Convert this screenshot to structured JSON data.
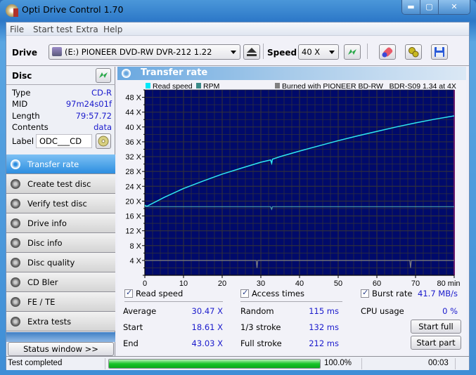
{
  "window": {
    "title": "Opti Drive Control 1.70",
    "buttons": {
      "minimize": "▬",
      "maximize": "▢",
      "close": "✕"
    }
  },
  "menu": [
    "File",
    "Start test",
    "Extra",
    "Help"
  ],
  "toolbar": {
    "drive_label": "Drive",
    "drive_value": "(E:)  PIONEER DVD-RW  DVR-212 1.22",
    "speed_label": "Speed",
    "speed_value": "40 X"
  },
  "disc": {
    "title": "Disc",
    "rows": [
      {
        "key": "Type",
        "value": "CD-R"
      },
      {
        "key": "MID",
        "value": "97m24s01f"
      },
      {
        "key": "Length",
        "value": "79:57.72"
      },
      {
        "key": "Contents",
        "value": "data"
      }
    ],
    "label_key": "Label",
    "label_value": "ODC___CD"
  },
  "nav": [
    {
      "label": "Transfer rate",
      "active": true
    },
    {
      "label": "Create test disc",
      "active": false
    },
    {
      "label": "Verify test disc",
      "active": false
    },
    {
      "label": "Drive info",
      "active": false
    },
    {
      "label": "Disc info",
      "active": false
    },
    {
      "label": "Disc quality",
      "active": false
    },
    {
      "label": "CD Bler",
      "active": false
    },
    {
      "label": "FE / TE",
      "active": false
    },
    {
      "label": "Extra tests",
      "active": false
    }
  ],
  "status_window_button": "Status window >>",
  "panel_title": "Transfer rate",
  "colors": {
    "plot_bg": "#000a6a",
    "grid": "#2e2e3e",
    "read_speed": "#2ee8f0",
    "rpm": "#4aa0a8",
    "burned": "#808080",
    "value_text": "#1a1acc",
    "progress": "#18c428"
  },
  "chart_data": {
    "type": "line",
    "legend": [
      {
        "name": "Read speed",
        "color": "#00e8f8"
      },
      {
        "name": "RPM",
        "color": "#3a8a88"
      },
      {
        "name": "Burned with PIONEER BD-RW   BDR-S09 1.34 at 4X",
        "color": "#808080"
      }
    ],
    "xlabel": "min",
    "x_ticks": [
      0,
      10,
      20,
      30,
      40,
      50,
      60,
      70,
      80
    ],
    "x_tick_labels": [
      "0",
      "10",
      "20",
      "30",
      "40",
      "50",
      "60",
      "70",
      "80 min"
    ],
    "y_ticks": [
      4,
      8,
      12,
      16,
      20,
      24,
      28,
      32,
      36,
      40,
      44,
      48
    ],
    "y_tick_labels": [
      "4 X",
      "8 X",
      "12 X",
      "16 X",
      "20 X",
      "24 X",
      "28 X",
      "32 X",
      "36 X",
      "40 X",
      "44 X",
      "48 X"
    ],
    "xlim": [
      0,
      80
    ],
    "ylim": [
      0,
      50
    ],
    "grid": true,
    "series": [
      {
        "name": "Read speed",
        "x": [
          0,
          0.5,
          5,
          10,
          15,
          20,
          25,
          30,
          32.5,
          32.8,
          33,
          35,
          40,
          45,
          50,
          55,
          60,
          65,
          70,
          75,
          80
        ],
        "y": [
          18.9,
          18.6,
          21.0,
          23.4,
          25.4,
          27.3,
          28.9,
          30.5,
          31.1,
          30.2,
          31.3,
          32.0,
          33.5,
          34.9,
          36.3,
          37.6,
          38.8,
          40.0,
          41.1,
          42.1,
          43.0
        ]
      },
      {
        "name": "RPM",
        "x": [
          0,
          10,
          20,
          30,
          32.5,
          32.8,
          33,
          40,
          50,
          60,
          70,
          80
        ],
        "y": [
          18.5,
          18.5,
          18.5,
          18.5,
          18.5,
          17.8,
          18.5,
          18.5,
          18.5,
          18.5,
          18.5,
          18.5
        ]
      },
      {
        "name": "Burned",
        "x": [
          0,
          10,
          20,
          28.8,
          29.0,
          29.2,
          30,
          40,
          50,
          60,
          68.5,
          68.7,
          68.9,
          70,
          80
        ],
        "y": [
          4.0,
          4.0,
          4.0,
          4.0,
          2.0,
          4.0,
          4.0,
          4.0,
          4.0,
          4.0,
          4.0,
          2.0,
          4.0,
          4.0,
          4.0
        ]
      }
    ]
  },
  "stats": {
    "read_speed": {
      "label": "Read speed",
      "rows": [
        {
          "key": "Average",
          "value": "30.47 X"
        },
        {
          "key": "Start",
          "value": "18.61 X"
        },
        {
          "key": "End",
          "value": "43.03 X"
        }
      ]
    },
    "access_times": {
      "label": "Access times",
      "rows": [
        {
          "key": "Random",
          "value": "115 ms"
        },
        {
          "key": "1/3 stroke",
          "value": "132 ms"
        },
        {
          "key": "Full stroke",
          "value": "212 ms"
        }
      ]
    },
    "burst_rate": {
      "label": "Burst rate",
      "value": "41.7 MB/s"
    },
    "cpu_usage": {
      "label": "CPU usage",
      "value": "0 %"
    },
    "start_full": "Start full",
    "start_part": "Start part"
  },
  "statusbar": {
    "text": "Test completed",
    "progress_percent": 100,
    "progress_label": "100.0%",
    "time": "00:03"
  }
}
